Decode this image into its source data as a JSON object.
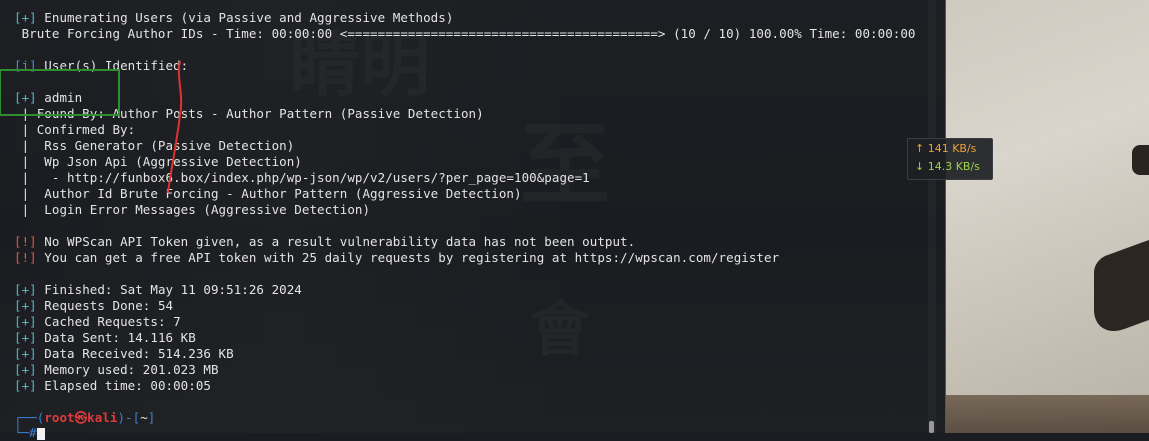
{
  "terminal": {
    "lines": {
      "l1_tag": "[+]",
      "l1_text": " Enumerating Users (via Passive and Aggressive Methods)",
      "l2_text": " Brute Forcing Author IDs - Time: 00:00:00 <=========================================> (10 / 10) 100.00% Time: 00:00:00",
      "l3_tag": "[i]",
      "l3_text": " User(s) Identified:",
      "l4_tag": "[+]",
      "l4_text": " admin",
      "l5_text": " | Found By: Author Posts - Author Pattern (Passive Detection)",
      "l6_text": " | Confirmed By:",
      "l7_text": " |  Rss Generator (Passive Detection)",
      "l8_text": " |  Wp Json Api (Aggressive Detection)",
      "l9_text": " |   - http://funbox6.box/index.php/wp-json/wp/v2/users/?per_page=100&page=1",
      "l10_text": " |  Author Id Brute Forcing - Author Pattern (Aggressive Detection)",
      "l11_text": " |  Login Error Messages (Aggressive Detection)",
      "l12_tag": "[!]",
      "l12_text": " No WPScan API Token given, as a result vulnerability data has not been output.",
      "l13_tag": "[!]",
      "l13_text": " You can get a free API token with 25 daily requests by registering at https://wpscan.com/register",
      "l14_tag": "[+]",
      "l14_text": " Finished: Sat May 11 09:51:26 2024",
      "l15_tag": "[+]",
      "l15_text": " Requests Done: 54",
      "l16_tag": "[+]",
      "l16_text": " Cached Requests: 7",
      "l17_tag": "[+]",
      "l17_text": " Data Sent: 14.116 KB",
      "l18_tag": "[+]",
      "l18_text": " Data Received: 514.236 KB",
      "l19_tag": "[+]",
      "l19_text": " Memory used: 201.023 MB",
      "l20_tag": "[+]",
      "l20_text": " Elapsed time: 00:00:05"
    },
    "prompt": {
      "corner": "┌──(",
      "user": "root㉿kali",
      "mid": ")-[",
      "dir": "~",
      "end": "]",
      "second": "└─#"
    }
  },
  "network_widget": {
    "upload": "↑ 141 KB/s",
    "download": "↓ 14.3 KB/s"
  },
  "colors": {
    "plus_tag": "#4fb8c4",
    "warn_tag": "#e5553c",
    "annotation_green": "#2f8f2f",
    "annotation_red": "#e0332f"
  }
}
